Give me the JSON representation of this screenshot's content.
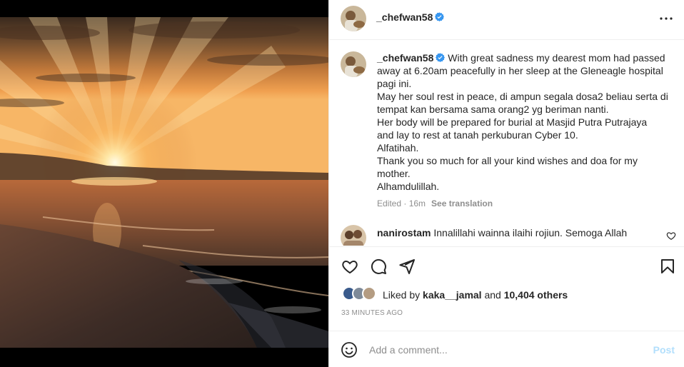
{
  "post": {
    "author": "_chefwan58",
    "verified": true
  },
  "caption": {
    "username": "_chefwan58",
    "lines": [
      "With great sadness my dearest mom had passed",
      "away at 6.20am peacefully in her sleep at the Gleneagle hospital",
      "pagi ini.",
      "May her soul rest in peace, di ampun segala dosa2 beliau serta di",
      "tempat kan bersama sama orang2 yg beriman nanti.",
      "Her body will be prepared for burial at Masjid Putra Putrajaya",
      "and lay to rest at tanah perkuburan Cyber 10.",
      "Alfatihah.",
      "Thank you so much for all your kind wishes and doa for my",
      "mother.",
      "Alhamdulillah."
    ],
    "edited_label": "Edited · 16m",
    "see_translation": "See translation"
  },
  "comment": {
    "username": "nanirostam",
    "text": "Innalillahi wainna ilaihi rojiun. Semoga Allah"
  },
  "likes": {
    "prefix": "Liked by",
    "liker": "kaka__jamal",
    "conjunction": "and",
    "others": "10,404 others"
  },
  "timestamp": "33 MINUTES AGO",
  "add_comment": {
    "placeholder": "Add a comment...",
    "post_label": "Post"
  },
  "icons": {
    "verified": "verified-badge-icon",
    "more": "more-options-icon",
    "like": "heart-icon",
    "comment": "comment-icon",
    "share": "share-icon",
    "save": "bookmark-icon",
    "emoji": "emoji-icon"
  },
  "colors": {
    "verified_blue": "#3897f0",
    "post_button_disabled": "#b2dffc",
    "muted_text": "#8e8e8e"
  }
}
